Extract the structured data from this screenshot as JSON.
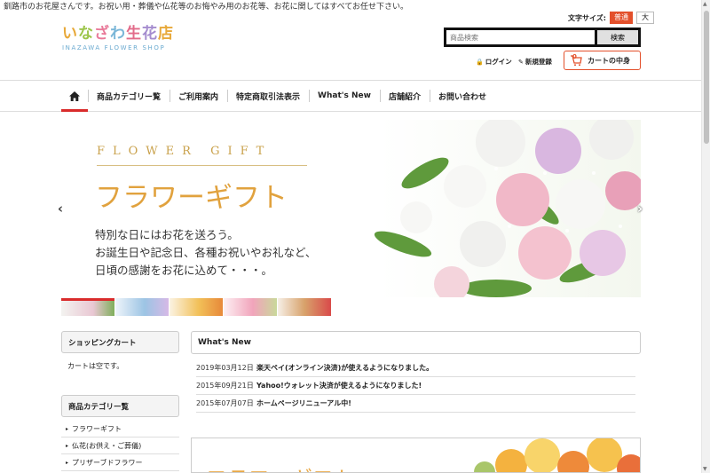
{
  "tagline": "釧路市のお花屋さんです。お祝い用・葬儀や仏花等のお悔やみ用のお花等、お花に関してはすべてお任せ下さい。",
  "logo": {
    "jp": "いなざわ生花店",
    "en": "INAZAWA FLOWER SHOP"
  },
  "font_size": {
    "label": "文字サイズ:",
    "normal": "普通",
    "large": "大"
  },
  "search": {
    "placeholder": "商品検索",
    "button": "検索"
  },
  "account": {
    "login": "ログイン",
    "register": "新規登録"
  },
  "cart": {
    "count": "0",
    "label": "カートの中身"
  },
  "nav": [
    "商品カテゴリー覧",
    "ご利用案内",
    "特定商取引法表示",
    "What's New",
    "店舗紹介",
    "お問い合わせ"
  ],
  "banner": {
    "en": "FLOWER GIFT",
    "jp": "フラワーギフト",
    "copy": [
      "特別な日にはお花を送ろう。",
      "お誕生日や記念日、各種お祝いやお礼など、",
      "日頃の感謝をお花に込めて・・・。"
    ]
  },
  "sidebar": {
    "cart_title": "ショッピングカート",
    "cart_empty": "カートは空です。",
    "category_title": "商品カテゴリー覧",
    "categories": [
      "フラワーギフト",
      "仏花(お供え・ご葬儀)",
      "プリザーブドフラワー"
    ]
  },
  "news": {
    "title": "What's New",
    "items": [
      {
        "date": "2019年03月12日",
        "title": "楽天ペイ(オンライン決済)が使えるようになりました。"
      },
      {
        "date": "2015年09月21日",
        "title": "Yahoo!ウォレット決済が使えるようになりました!"
      },
      {
        "date": "2015年07月07日",
        "title": "ホームページリニューアル中!"
      }
    ]
  },
  "sub_banner": {
    "text": "フラワーギフト"
  },
  "colors": {
    "accent": "#e3502b",
    "nav_active": "#d92b2b",
    "banner_gold": "#e1a23e"
  }
}
